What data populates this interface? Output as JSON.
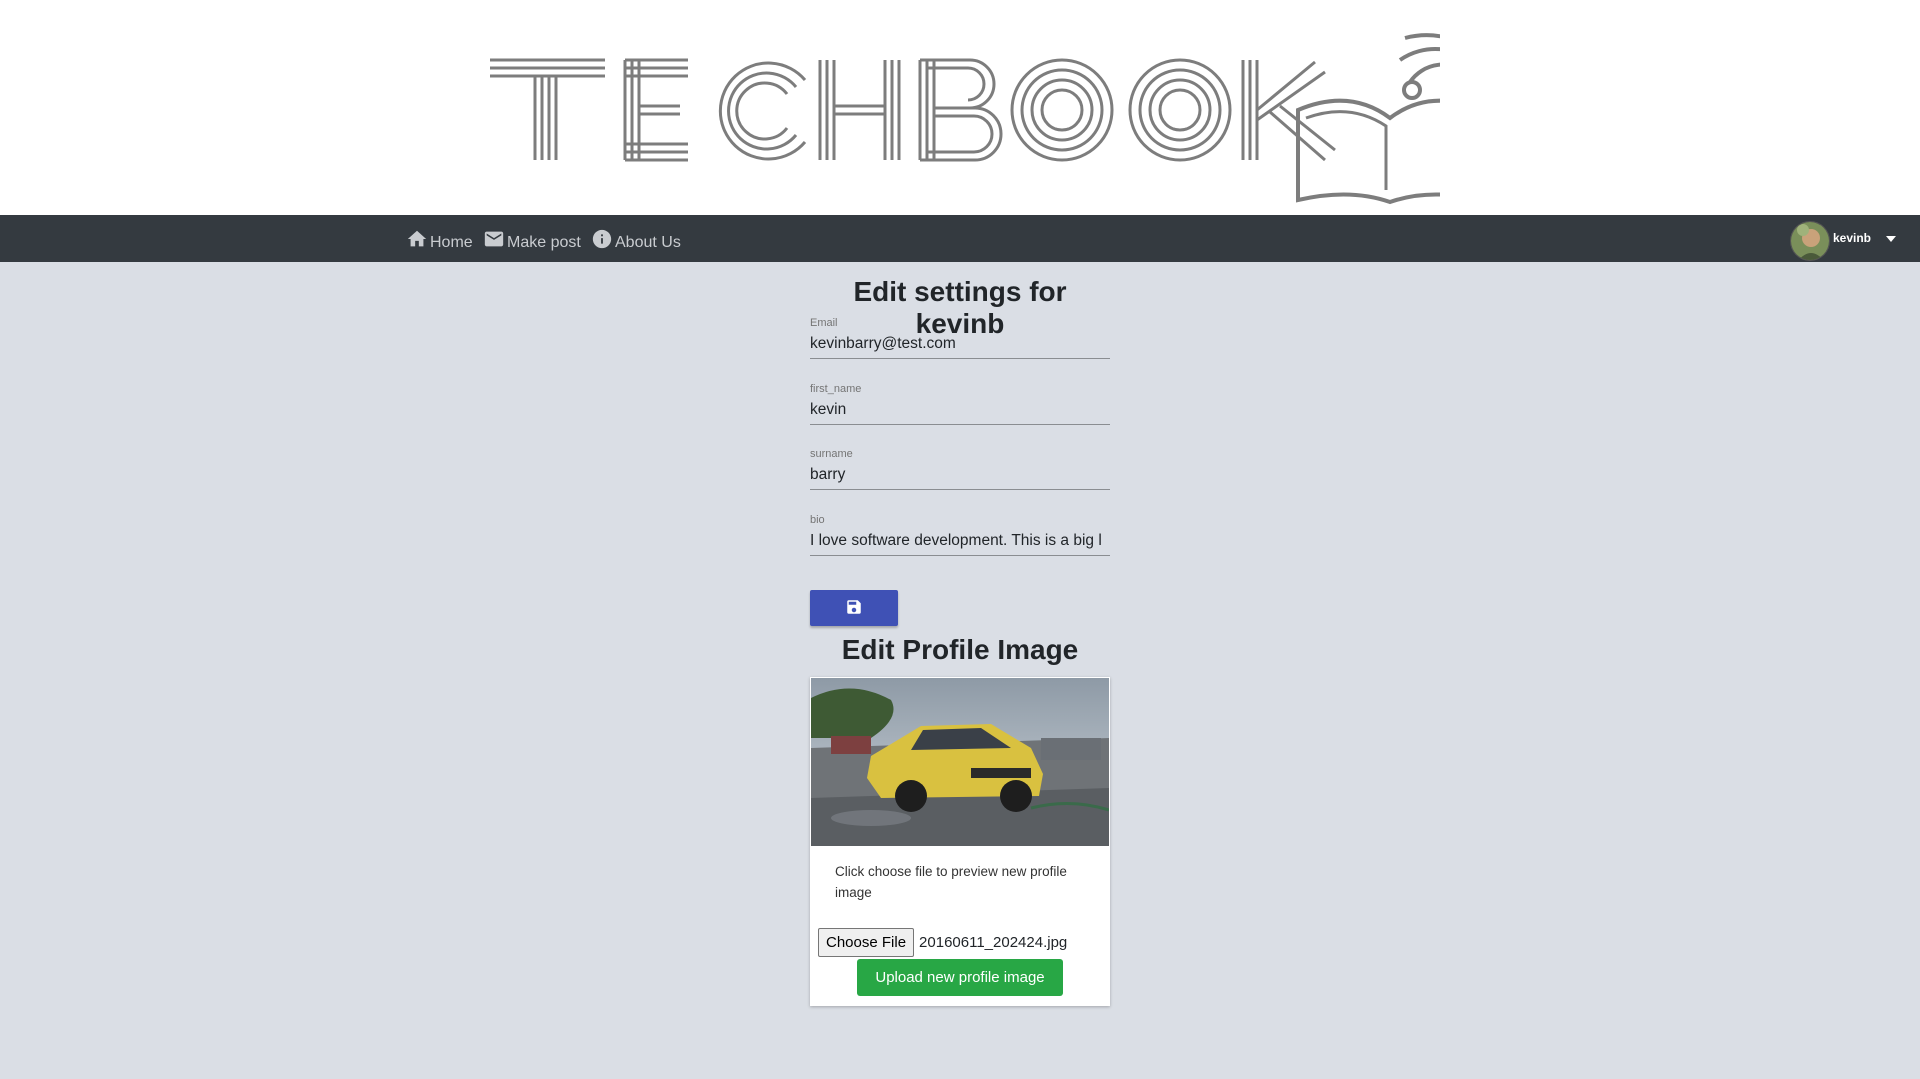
{
  "logo": {
    "text": "TechBook"
  },
  "nav": {
    "items": [
      {
        "label": "Home",
        "icon": "home-icon"
      },
      {
        "label": "Make post",
        "icon": "mail-icon"
      },
      {
        "label": "About Us",
        "icon": "info-icon"
      }
    ],
    "user": {
      "name": "kevinb",
      "icon": "caret-down-icon"
    }
  },
  "settings": {
    "title_prefix": "Edit settings for ",
    "title_user": "kevinb",
    "fields": [
      {
        "label": "Email",
        "value": "kevinbarry@test.com"
      },
      {
        "label": "first_name",
        "value": "kevin"
      },
      {
        "label": "surname",
        "value": "barry"
      },
      {
        "label": "bio",
        "value": "I love software development. This is a big l"
      }
    ],
    "save_icon": "floppy-disk-icon"
  },
  "profile_image": {
    "title": "Edit Profile Image",
    "help_text": "Click choose file to preview new profile image",
    "choose_label": "Choose File",
    "file_name": "20160611_202424.jpg",
    "upload_label": "Upload new profile image"
  },
  "colors": {
    "navbar": "#343a40",
    "background": "#dadee5",
    "save_button": "#3f51b5",
    "upload_button": "#28a745"
  }
}
